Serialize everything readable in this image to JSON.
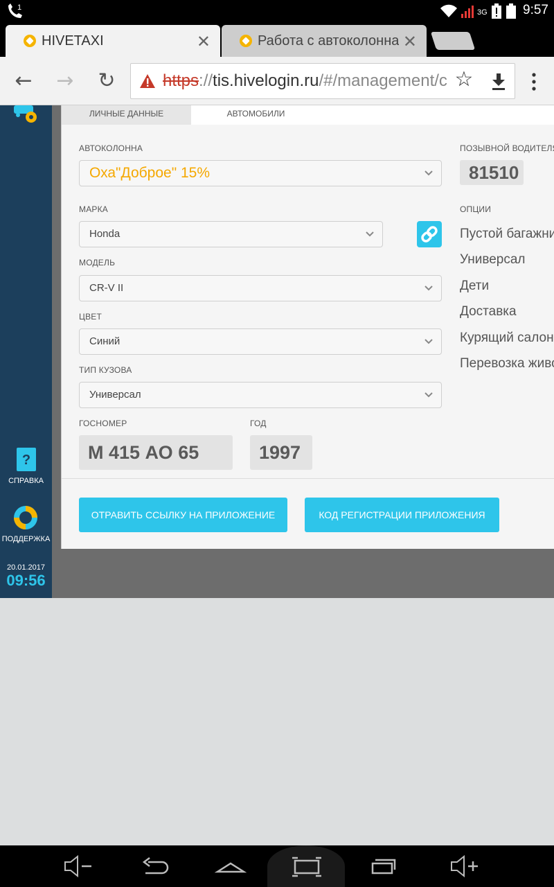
{
  "status_bar": {
    "time": "9:57",
    "network": "3G",
    "icons": [
      "phone-missed-icon",
      "wifi-icon",
      "signal-icon",
      "battery-alert-icon"
    ]
  },
  "browser": {
    "tabs": [
      {
        "title": "HIVETAXI",
        "active": true
      },
      {
        "title": "Работа с автоколоннами",
        "active": false
      }
    ],
    "url_scheme": "https",
    "url_sep": "://",
    "url_host": "tis.hivelogin.ru",
    "url_path": "/#/management/c"
  },
  "sidebar": {
    "help_label": "СПРАВКА",
    "support_label": "ПОДДЕРЖКА",
    "date": "20.01.2017",
    "time": "09:56"
  },
  "panel": {
    "tabs": [
      "ЛИЧНЫЕ ДАННЫЕ",
      "АВТОМОБИЛИ"
    ],
    "active_tab": 1,
    "fleet": {
      "label": "АВТОКОЛОННА",
      "value": "Оха\"Доброе\" 15%"
    },
    "brand": {
      "label": "МАРКА",
      "value": "Honda"
    },
    "model": {
      "label": "МОДЕЛЬ",
      "value": "CR-V II"
    },
    "color": {
      "label": "ЦВЕТ",
      "value": "Синий"
    },
    "body": {
      "label": "ТИП КУЗОВА",
      "value": "Универсал"
    },
    "plate": {
      "label": "ГОСНОМЕР",
      "value": "М 415 АО 65"
    },
    "year": {
      "label": "ГОД",
      "value": "1997"
    },
    "callsign": {
      "label": "ПОЗЫВНОЙ ВОДИТЕЛЯ",
      "value": "81510"
    },
    "options_label": "ОПЦИИ",
    "options": [
      "Пустой багажник",
      "Универсал",
      "Дети",
      "Доставка",
      "Курящий салон",
      "Перевозка животных"
    ],
    "button_link": "ОТРАВИТЬ ССЫЛКУ НА ПРИЛОЖЕНИЕ",
    "button_code": "КОД РЕГИСТРАЦИИ ПРИЛОЖЕНИЯ"
  },
  "colors": {
    "accent": "#2ec5ea",
    "sidebar": "#1c3f5c",
    "fleet_text": "#f5a800"
  }
}
